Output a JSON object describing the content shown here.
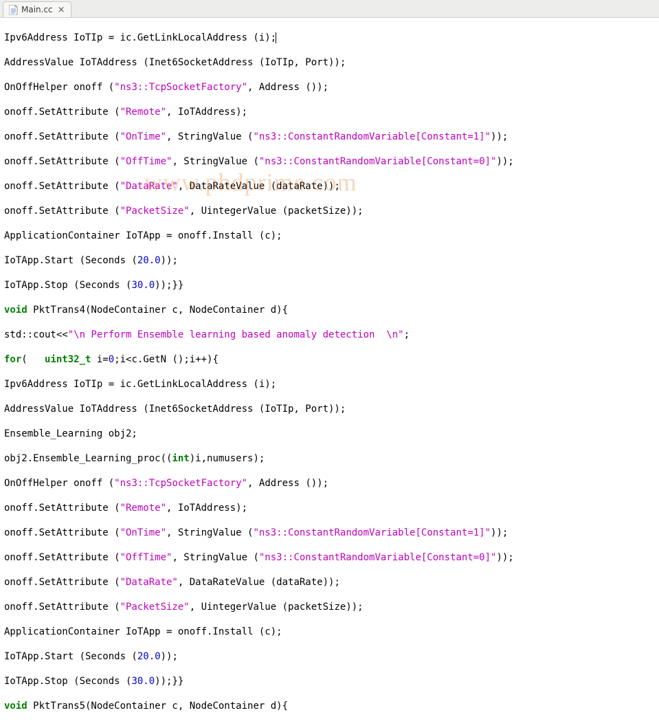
{
  "tab": {
    "filename": "Main.cc",
    "close_glyph": "×"
  },
  "watermark": "www.phdprime.com",
  "code": {
    "l1": {
      "a": "Ipv6Address IoTIp = ic.GetLinkLocalAddress (i);"
    },
    "l2": {
      "a": "AddressValue IoTAddress (Inet6SocketAddress (IoTIp, Port));"
    },
    "l3": {
      "a": "OnOffHelper onoff (",
      "s1": "\"ns3::TcpSocketFactory\"",
      "b": ", Address ());"
    },
    "l4": {
      "a": "onoff.SetAttribute (",
      "s1": "\"Remote\"",
      "b": ", IoTAddress);"
    },
    "l5": {
      "a": "onoff.SetAttribute (",
      "s1": "\"OnTime\"",
      "b": ", StringValue (",
      "s2": "\"ns3::ConstantRandomVariable[Constant=1]\"",
      "c": "));"
    },
    "l6": {
      "a": "onoff.SetAttribute (",
      "s1": "\"OffTime\"",
      "b": ", StringValue (",
      "s2": "\"ns3::ConstantRandomVariable[Constant=0]\"",
      "c": "));"
    },
    "l7": {
      "a": "onoff.SetAttribute (",
      "s1": "\"DataRate\"",
      "b": ", DataRateValue (dataRate));"
    },
    "l8": {
      "a": "onoff.SetAttribute (",
      "s1": "\"PacketSize\"",
      "b": ", UintegerValue (packetSize));"
    },
    "l9": {
      "a": "ApplicationContainer IoTApp = onoff.Install (c);"
    },
    "l10": {
      "a": "IoTApp.Start (Seconds (",
      "n1": "20.0",
      "b": "));"
    },
    "l11": {
      "a": "IoTApp.Stop (Seconds (",
      "n1": "30.0",
      "b": "));}}"
    },
    "l12": {
      "kw": "void",
      "a": " PktTrans4(NodeContainer c, NodeContainer d){"
    },
    "l13": {
      "a": "std::cout<<",
      "s1": "\"\\n Perform Ensemble learning based anomaly detection  \\n\"",
      "b": ";"
    },
    "l14": {
      "kw": "for",
      "a": "(   ",
      "ty": "uint32_t",
      "b": " i=",
      "n1": "0",
      "c": ";i<c.GetN ();i++){"
    },
    "l15": {
      "a": "Ipv6Address IoTIp = ic.GetLinkLocalAddress (i);"
    },
    "l16": {
      "a": "AddressValue IoTAddress (Inet6SocketAddress (IoTIp, Port));"
    },
    "l17": {
      "a": "Ensemble_Learning obj2;"
    },
    "l18": {
      "a": "obj2.Ensemble_Learning_proc((",
      "ty": "int",
      "b": ")i,numusers);"
    },
    "l19": {
      "a": "OnOffHelper onoff (",
      "s1": "\"ns3::TcpSocketFactory\"",
      "b": ", Address ());"
    },
    "l20": {
      "a": "onoff.SetAttribute (",
      "s1": "\"Remote\"",
      "b": ", IoTAddress);"
    },
    "l21": {
      "a": "onoff.SetAttribute (",
      "s1": "\"OnTime\"",
      "b": ", StringValue (",
      "s2": "\"ns3::ConstantRandomVariable[Constant=1]\"",
      "c": "));"
    },
    "l22": {
      "a": "onoff.SetAttribute (",
      "s1": "\"OffTime\"",
      "b": ", StringValue (",
      "s2": "\"ns3::ConstantRandomVariable[Constant=0]\"",
      "c": "));"
    },
    "l23": {
      "a": "onoff.SetAttribute (",
      "s1": "\"DataRate\"",
      "b": ", DataRateValue (dataRate));"
    },
    "l24": {
      "a": "onoff.SetAttribute (",
      "s1": "\"PacketSize\"",
      "b": ", UintegerValue (packetSize));"
    },
    "l25": {
      "a": "ApplicationContainer IoTApp = onoff.Install (c);"
    },
    "l26": {
      "a": "IoTApp.Start (Seconds (",
      "n1": "20.0",
      "b": "));"
    },
    "l27": {
      "a": "IoTApp.Stop (Seconds (",
      "n1": "30.0",
      "b": "));}}"
    },
    "l28": {
      "kw": "void",
      "a": " PktTrans5(NodeContainer c, NodeContainer d){"
    }
  }
}
